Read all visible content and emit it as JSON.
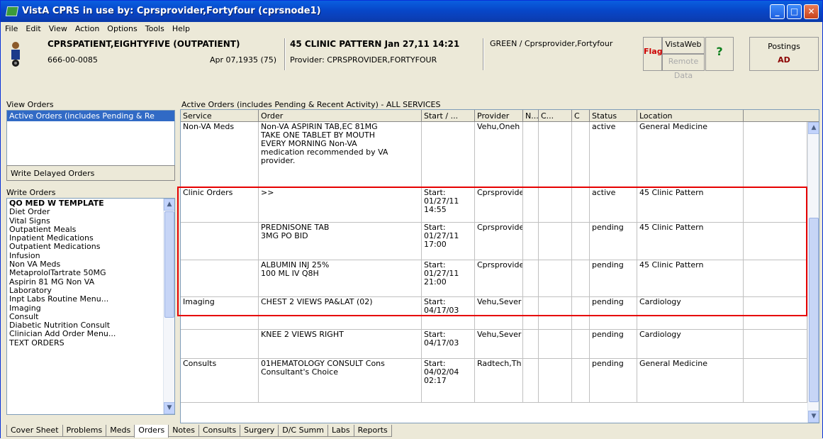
{
  "window": {
    "title": "VistA CPRS in use by: Cprsprovider,Fortyfour  (cprsnode1)"
  },
  "menu": [
    "File",
    "Edit",
    "View",
    "Action",
    "Options",
    "Tools",
    "Help"
  ],
  "patient": {
    "name": "CPRSPATIENT,EIGHTYFIVE (OUTPATIENT)",
    "ssn": "666-00-0085",
    "dob_age": "Apr 07,1935 (75)",
    "encounter": "45 CLINIC PATTERN Jan 27,11 14:21",
    "provider": "Provider:  CPRSPROVIDER,FORTYFOUR",
    "team": "GREEN / Cprsprovider,Fortyfour"
  },
  "toolbar": {
    "flag": "Flag",
    "vistaweb": "VistaWeb",
    "remote_data": "Remote Data",
    "help": "?",
    "postings_label": "Postings",
    "postings_value": "AD"
  },
  "left": {
    "view_orders_label": "View Orders",
    "view_orders_selected": "Active Orders (includes Pending & Re",
    "write_delayed": "Write Delayed Orders",
    "write_orders_label": "Write Orders",
    "write_orders": [
      "QO MED W TEMPLATE",
      "Diet Order",
      "Vital Signs",
      "Outpatient Meals",
      "Inpatient Medications",
      "Outpatient Medications",
      "Infusion",
      "Non VA Meds",
      "MetaprololTartrate 50MG",
      "Aspirin 81 MG Non VA",
      "Laboratory",
      "Inpt Labs Routine Menu...",
      "Imaging",
      "Consult",
      "Diabetic Nutrition Consult",
      "Clinician Add Order Menu...",
      "TEXT ORDERS"
    ]
  },
  "grid": {
    "title": "Active Orders (includes Pending & Recent Activity) - ALL SERVICES",
    "columns": [
      "Service",
      "Order",
      "Start / ...",
      "Provider",
      "N...",
      "C...",
      "C",
      "Status",
      "Location"
    ],
    "rows": [
      {
        "service": "Non-VA Meds",
        "order": "Non-VA ASPIRIN TAB,EC  81MG\nTAKE ONE TABLET BY MOUTH\nEVERY MORNING  Non-VA\nmedication recommended by VA\nprovider.",
        "start": "",
        "provider": "Vehu,Oneh",
        "status": "active",
        "location": "General Medicine"
      },
      {
        "service": "Clinic Orders",
        "order": ">>",
        "start": "Start:\n01/27/11\n14:55",
        "provider": "Cprsprovide",
        "status": "active",
        "location": "45 Clinic Pattern"
      },
      {
        "service": "",
        "order": "PREDNISONE TAB\n3MG PO BID",
        "start": "Start:\n01/27/11\n17:00",
        "provider": "Cprsprovide",
        "status": "pending",
        "location": "45 Clinic Pattern"
      },
      {
        "service": "",
        "order": "ALBUMIN INJ 25%\n100 ML IV Q8H",
        "start": "Start:\n01/27/11\n21:00",
        "provider": "Cprsprovide",
        "status": "pending",
        "location": "45 Clinic Pattern"
      },
      {
        "service": "Imaging",
        "order": "CHEST 2 VIEWS PA&LAT (02)",
        "start": "Start:\n04/17/03",
        "provider": "Vehu,Sever",
        "status": "pending",
        "location": "Cardiology"
      },
      {
        "service": "",
        "order": "KNEE 2 VIEWS RIGHT",
        "start": "Start:\n04/17/03",
        "provider": "Vehu,Sever",
        "status": "pending",
        "location": "Cardiology"
      },
      {
        "service": "Consults",
        "order": "01HEMATOLOGY CONSULT Cons\nConsultant's Choice",
        "start": "Start:\n04/02/04\n02:17",
        "provider": "Radtech,Th",
        "status": "pending",
        "location": "General Medicine"
      }
    ]
  },
  "tabs": [
    "Cover Sheet",
    "Problems",
    "Meds",
    "Orders",
    "Notes",
    "Consults",
    "Surgery",
    "D/C Summ",
    "Labs",
    "Reports"
  ],
  "active_tab": "Orders"
}
